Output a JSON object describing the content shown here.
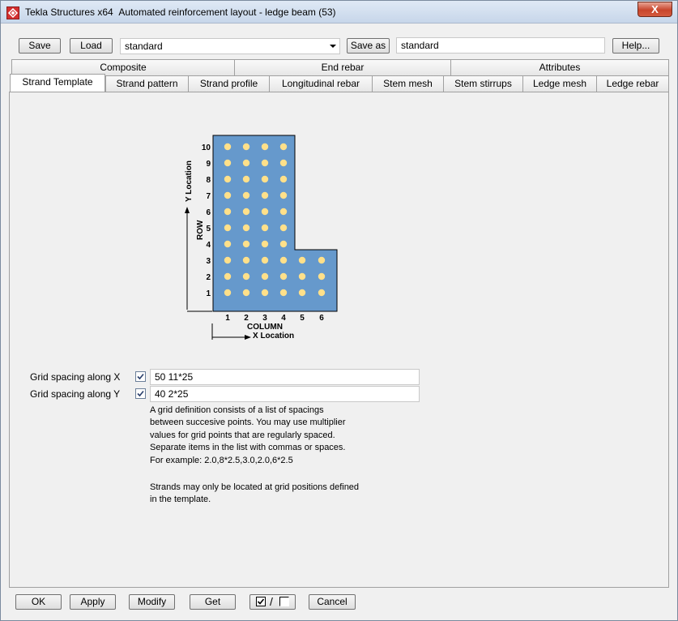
{
  "window": {
    "app_name": "Tekla Structures x64",
    "dialog_title": "Automated reinforcement layout - ledge beam (53)",
    "close_glyph": "X"
  },
  "toolbar": {
    "save_label": "Save",
    "load_label": "Load",
    "load_value": "standard",
    "save_as_label": "Save as",
    "save_as_value": "standard",
    "help_label": "Help..."
  },
  "tabs": {
    "row_top": [
      {
        "label": "Composite"
      },
      {
        "label": "End rebar"
      },
      {
        "label": "Attributes"
      }
    ],
    "row_bottom": [
      {
        "label": "Strand Template",
        "active": true
      },
      {
        "label": "Strand pattern"
      },
      {
        "label": "Strand profile"
      },
      {
        "label": "Longitudinal rebar"
      },
      {
        "label": "Stem mesh"
      },
      {
        "label": "Stem stirrups"
      },
      {
        "label": "Ledge mesh"
      },
      {
        "label": "Ledge rebar"
      }
    ]
  },
  "figure": {
    "y_axis_label": "Y Location",
    "row_label": "ROW",
    "column_label": "COLUMN",
    "x_axis_label": "X Location",
    "row_numbers": [
      "10",
      "9",
      "8",
      "7",
      "6",
      "5",
      "4",
      "3",
      "2",
      "1"
    ],
    "column_numbers": [
      "1",
      "2",
      "3",
      "4",
      "5",
      "6"
    ],
    "colors": {
      "section_fill": "#6699cc",
      "strand_fill": "#ffe08a",
      "outline": "#000000"
    }
  },
  "grid": {
    "x_label": "Grid spacing along X",
    "x_checked": true,
    "x_value": "50 11*25",
    "y_label": "Grid spacing along Y",
    "y_checked": true,
    "y_value": "40 2*25"
  },
  "help_text": {
    "line1": "A grid definition consists of a list of spacings",
    "line2": "between succesive points.  You may use multiplier",
    "line3": "values for grid points that are regularly spaced.",
    "line4": "Separate items in the list with commas or spaces.",
    "line5": "For example: 2.0,8*2.5,3.0,2.0,6*2.5",
    "line6": "Strands may only be located at grid positions defined",
    "line7": "in the template."
  },
  "footer": {
    "ok_label": "OK",
    "apply_label": "Apply",
    "modify_label": "Modify",
    "get_label": "Get",
    "toggle_separator": "/",
    "cancel_label": "Cancel"
  }
}
